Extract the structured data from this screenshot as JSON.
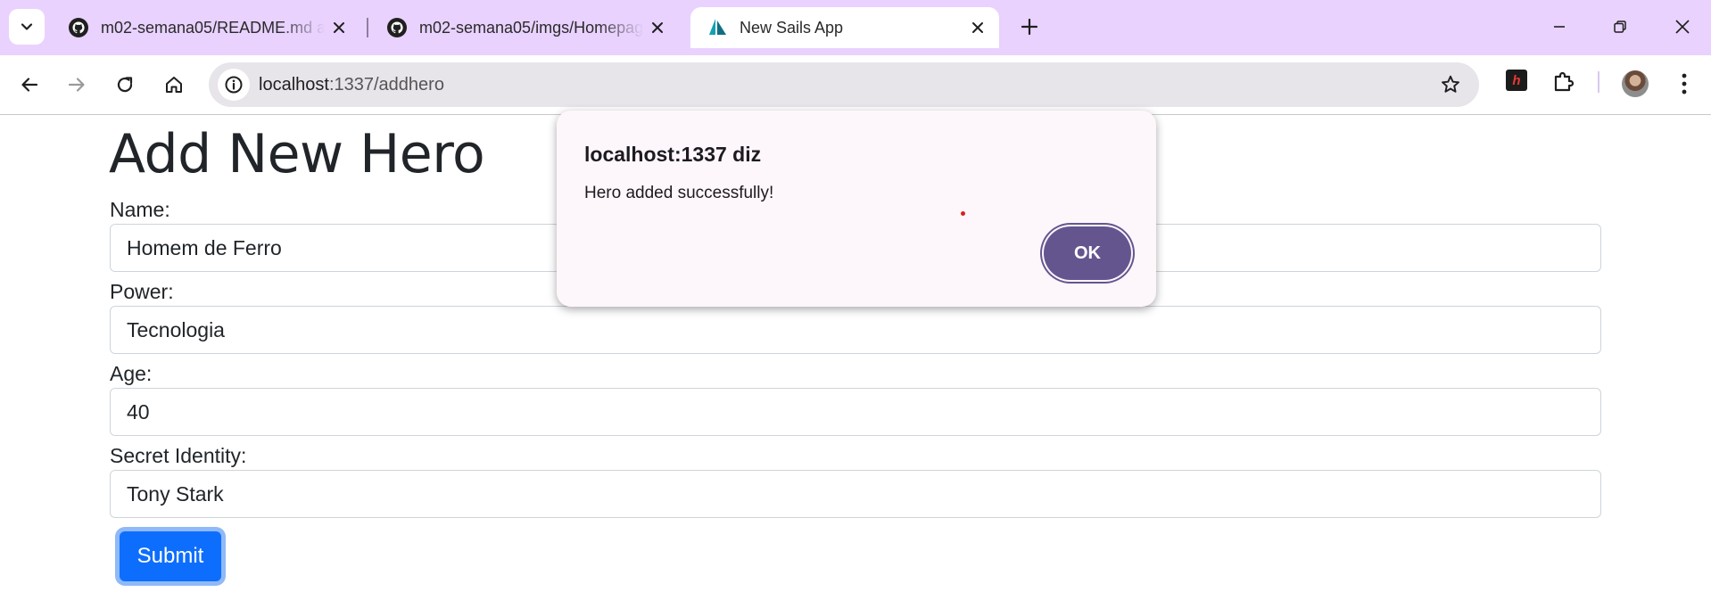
{
  "browser": {
    "tabs": [
      {
        "title": "m02-semana05/README.md at",
        "favicon": "github-icon"
      },
      {
        "title": "m02-semana05/imgs/Homepag",
        "favicon": "github-icon"
      },
      {
        "title": "New Sails App",
        "favicon": "sails-icon",
        "active": true
      }
    ],
    "address": {
      "host": "localhost",
      "path": ":1337/addhero"
    }
  },
  "page": {
    "title": "Add New Hero",
    "fields": [
      {
        "label": "Name:",
        "value": "Homem de Ferro"
      },
      {
        "label": "Power:",
        "value": "Tecnologia"
      },
      {
        "label": "Age:",
        "value": "40"
      },
      {
        "label": "Secret Identity:",
        "value": "Tony Stark"
      }
    ],
    "submit_label": "Submit"
  },
  "dialog": {
    "title": "localhost:1337 diz",
    "message": "Hero added successfully!",
    "ok_label": "OK"
  },
  "extension": {
    "label": "h"
  },
  "colors": {
    "tabstrip": "#e9d2fe",
    "primary_button": "#0d6efd",
    "dialog_button": "#65558f",
    "dialog_bg": "#fdf7fc"
  }
}
